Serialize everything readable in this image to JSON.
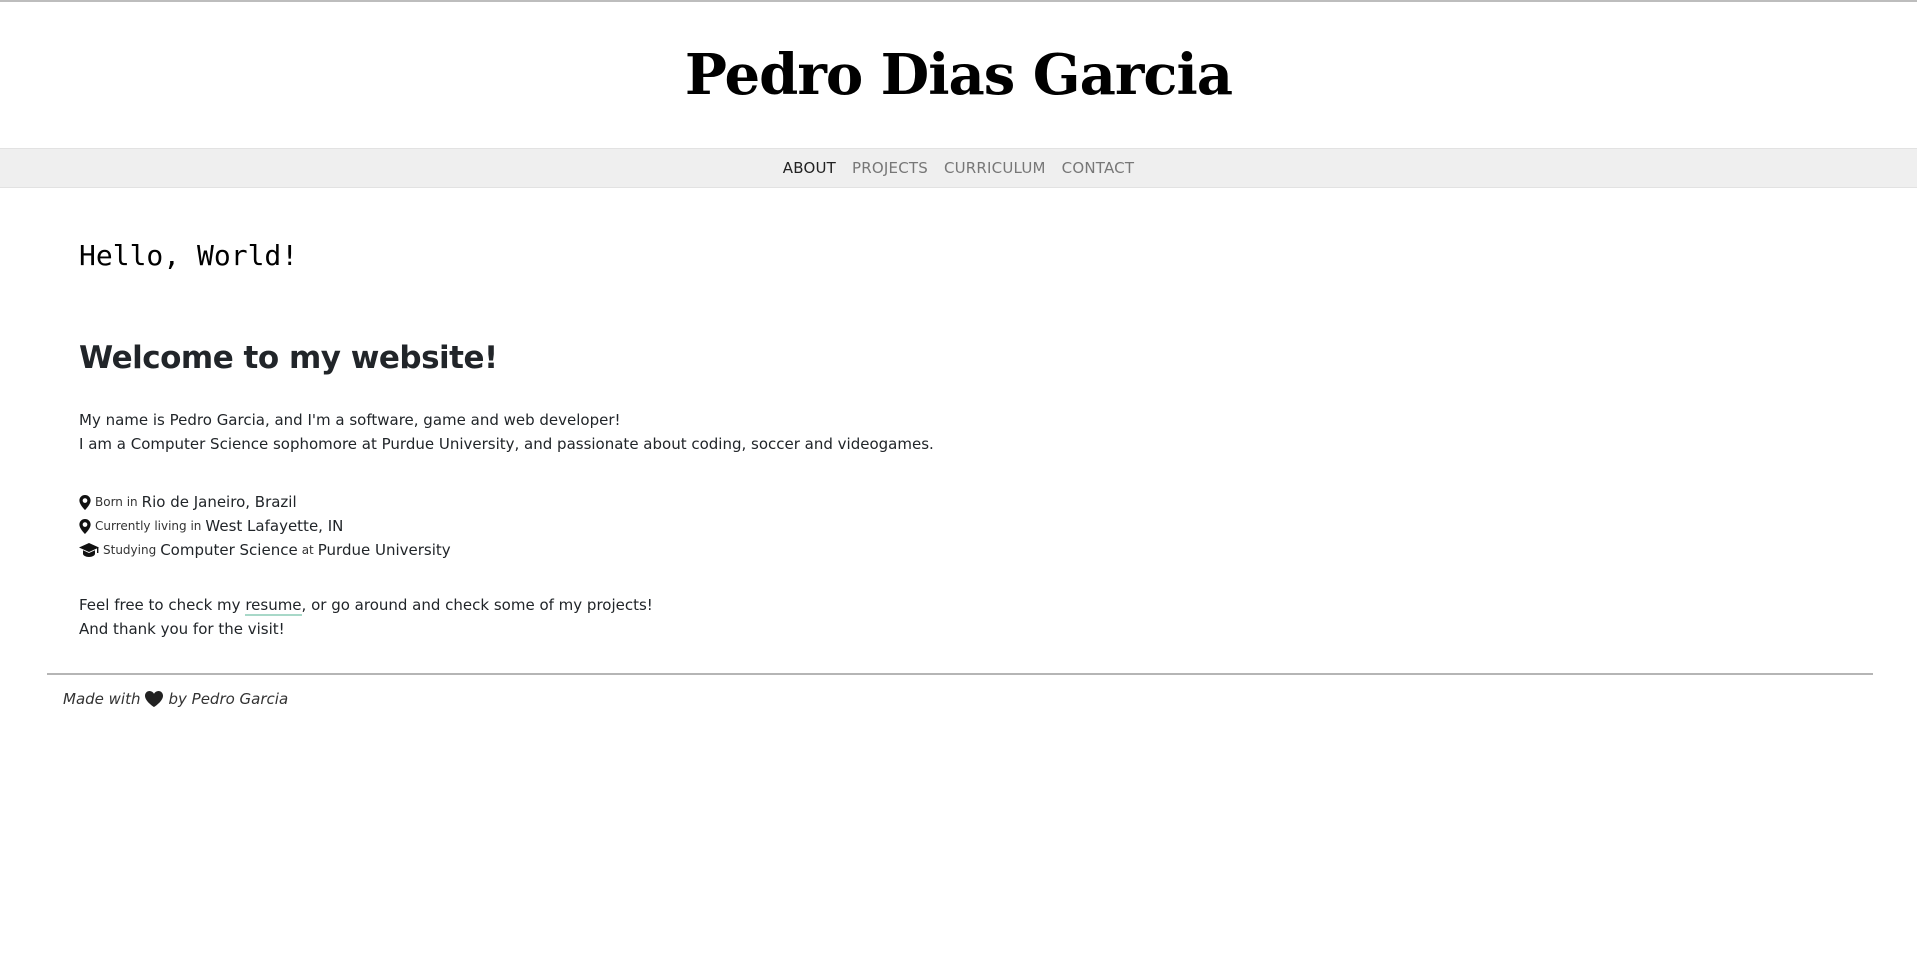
{
  "header": {
    "title": "Pedro Dias Garcia"
  },
  "nav": {
    "items": [
      {
        "label": "ABOUT",
        "active": true
      },
      {
        "label": "PROJECTS",
        "active": false
      },
      {
        "label": "CURRICULUM",
        "active": false
      },
      {
        "label": "CONTACT",
        "active": false
      }
    ]
  },
  "main": {
    "hello": "Hello, World!",
    "welcome": "Welcome to my website!",
    "intro_line1": "My name is Pedro Garcia, and I'm a software, game and web developer!",
    "intro_line2": "I am a Computer Science sophomore at Purdue University, and passionate about coding, soccer and videogames.",
    "facts": [
      {
        "icon": "map-marker-icon",
        "prefix": "Born in",
        "value": "Rio de Janeiro, Brazil"
      },
      {
        "icon": "map-marker-icon",
        "prefix": "Currently living in",
        "value": "West Lafayette, IN"
      },
      {
        "icon": "graduation-cap-icon",
        "prefix": "Studying",
        "value": "Computer Science",
        "connector": "at",
        "value2": "Purdue University"
      }
    ],
    "outro_before": "Feel free to check my ",
    "outro_link": "resume",
    "outro_after": ", or go around and check some of my projects!",
    "outro_line2": "And thank you for the visit!"
  },
  "footer": {
    "made_with": "Made with",
    "by": "by Pedro Garcia",
    "heart_icon": "heart-icon"
  },
  "colors": {
    "nav_background": "#efefef",
    "nav_inactive": "#777777",
    "nav_active": "#222222",
    "link_underline": "#a8d8c8",
    "text": "#212529"
  }
}
